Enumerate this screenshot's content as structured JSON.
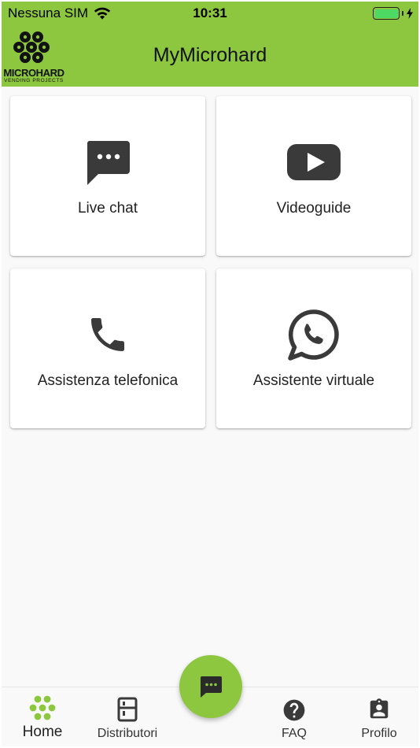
{
  "status_bar": {
    "carrier": "Nessuna SIM",
    "time": "10:31"
  },
  "header": {
    "title": "MyMicrohard",
    "logo_text": "MICROHARD",
    "logo_subtext": "VENDING PROJECTS"
  },
  "cards": [
    {
      "label": "Live chat",
      "icon": "chat-bubble-icon"
    },
    {
      "label": "Videoguide",
      "icon": "video-play-icon"
    },
    {
      "label": "Assistenza telefonica",
      "icon": "phone-icon"
    },
    {
      "label": "Assistente virtuale",
      "icon": "whatsapp-icon"
    }
  ],
  "bottom_nav": {
    "items": [
      {
        "label": "Home",
        "icon": "dots-grid-icon",
        "active": true
      },
      {
        "label": "Distributori",
        "icon": "vending-machine-icon",
        "active": false
      },
      {
        "label": "FAQ",
        "icon": "help-circle-icon",
        "active": false
      },
      {
        "label": "Profilo",
        "icon": "profile-badge-icon",
        "active": false
      }
    ],
    "fab_icon": "chat-bubble-icon"
  },
  "colors": {
    "brand_green": "#8dc63f",
    "icon_dark": "#3a3a3a",
    "background": "#f9f9f9",
    "battery_green": "#4cd964"
  }
}
